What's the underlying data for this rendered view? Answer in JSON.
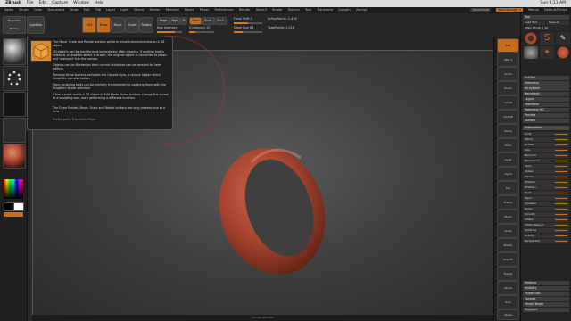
{
  "mac_menu": {
    "apple": "",
    "app": "ZBrush",
    "items": [
      "File",
      "Edit",
      "Capture",
      "Window",
      "Help"
    ],
    "status": "Sun 9:11 AM"
  },
  "zbrush_menu": {
    "items": [
      "Alpha",
      "Brush",
      "Color",
      "Document",
      "Draw",
      "Edit",
      "File",
      "Layer",
      "Light",
      "Macro",
      "Marker",
      "Material",
      "Movie",
      "Picker",
      "Preferences",
      "Render",
      "Stencil",
      "Stroke",
      "Texture",
      "Tool",
      "Transform",
      "Zplugin",
      "Zscript"
    ],
    "quicksave": "QuickSave",
    "see_through": "See-through 0",
    "menus": "Menus",
    "default_zscript": "DefaultZScript"
  },
  "top_toolbar": {
    "projection_master": "Projection Master",
    "lightbox": "LightBox",
    "edit": "Edit",
    "draw": "Draw",
    "move": "Move",
    "scale": "Scale",
    "rotate": "Rotate",
    "mrgb": "Mrgb",
    "rgb": "Rgb",
    "m": "M",
    "zadd": "Zadd",
    "zsub": "Zsub",
    "zcut": "Zcut",
    "rgb_intensity": "Rgb Intensity",
    "z_intensity": "Z Intensity 25",
    "focal_shift": "Focal Shift 0",
    "draw_size": "Draw Size 64",
    "active_points": "ActivePoints: 2,416",
    "total_points": "TotalPoints: 2,416"
  },
  "tooltip": {
    "title_text": "The Move, Scale and Rotate buttons perform these transformations on a 3D object.",
    "p1": "3D objects can be transformed immediately after drawing. If another tool is selected, or another object is drawn, the original object is converted to pixols and 'stamped' into the canvas.",
    "p2": "Objects can be Marked so their current attributes can be recalled for later editing.",
    "p3": "Pressing these buttons activates the Canvas Gyro, a unique helper which simplifies transformation.",
    "p4": "Many sculpting tools can be similarly transformed by applying them with the DragRect stroke selected.",
    "p5": "If the current tool is a 3D object in Edit Mode, these buttons change the cursor to a sculpting tool, each performing a different function.",
    "p6": "The Draw Pointer, Move, Scale and Rotate buttons are only pressed one at a time.",
    "path": "Button path: Transform:Move"
  },
  "right_shelf": {
    "buttons": [
      "BPR",
      "SPix 3",
      "Scroll",
      "Zoom",
      "Actual",
      "AAHalf",
      "Persp",
      "Floor",
      "Local",
      "LSym",
      "Xyz",
      "Frame",
      "Move",
      "Scale",
      "Rotate",
      "Line Fill",
      "Transp",
      "Ghost",
      "Solo",
      "Xpose"
    ]
  },
  "right_palette": {
    "header": "Tool",
    "load_tool": "Load Tool",
    "save_as": "Save As",
    "tool_name": "RING_ThinB_1_50",
    "sections": [
      "SubTool",
      "Geometry",
      "ArrayMesh",
      "NanoMesh",
      "Layers",
      "FiberMesh",
      "Geometry HD",
      "Preview",
      "Surface",
      "Deformation"
    ],
    "deformation_items": [
      "Unify",
      "Offset",
      "Rotate",
      "Size",
      "Bend Arc",
      "Bend Curve",
      "Skew",
      "SSkew",
      "Flatten",
      "SFlatten",
      "RFlatten",
      "Twist",
      "Taper",
      "Squeeze",
      "Noise",
      "Smooth",
      "Inflate",
      "Inflate Balloon",
      "Spherize",
      "Gravity",
      "Perspective"
    ],
    "bottom": [
      "Masking",
      "Visibility",
      "Polygroups",
      "Contact",
      "Morph Target",
      "Polypaint"
    ]
  },
  "canvas": {
    "footer": "Canvas 640x360"
  },
  "colors": {
    "accent": "#c76b1d",
    "ring": "#a9452f",
    "canvas_bg": "#3c3c3c"
  }
}
